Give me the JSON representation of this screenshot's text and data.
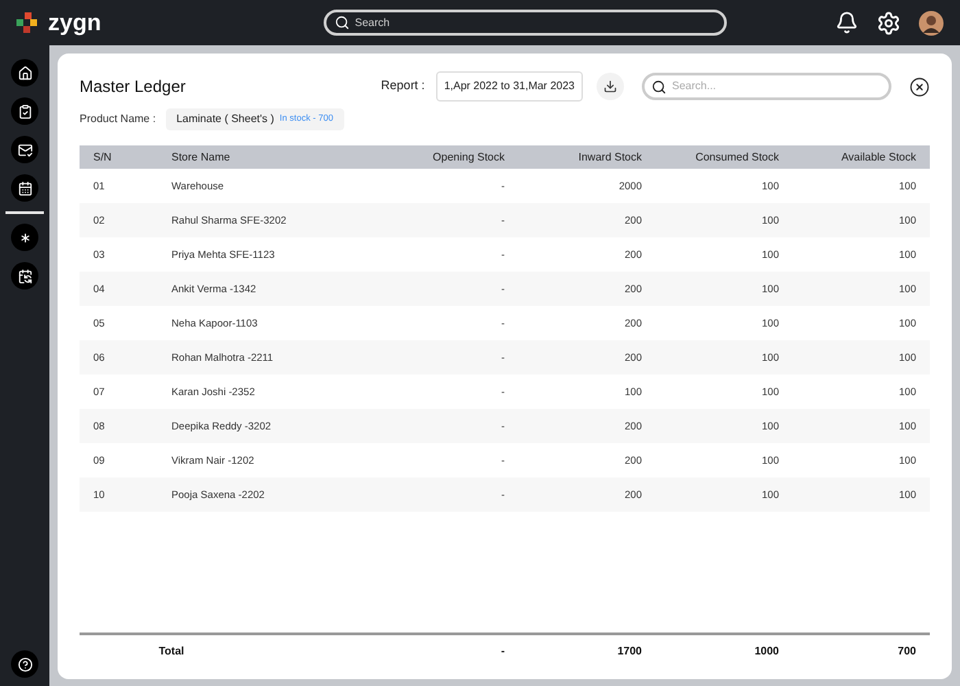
{
  "topbar": {
    "brand": "zygn",
    "search_placeholder": "Search"
  },
  "ledger": {
    "title": "Master Ledger",
    "report_label": "Report :",
    "report_range": "1,Apr 2022 to 31,Mar 2023",
    "search_placeholder": "Search...",
    "product_label": "Product Name :",
    "product": "Laminate ( Sheet's )",
    "stock_badge": "In stock - 700"
  },
  "table": {
    "columns": [
      "S/N",
      "Store Name",
      "Opening Stock",
      "Inward Stock",
      "Consumed Stock",
      "Available Stock"
    ],
    "rows": [
      [
        "01",
        "Warehouse",
        "-",
        "2000",
        "100",
        "100"
      ],
      [
        "02",
        "Rahul Sharma SFE-3202",
        "-",
        "200",
        "100",
        "100"
      ],
      [
        "03",
        "Priya Mehta SFE-1123",
        "-",
        "200",
        "100",
        "100"
      ],
      [
        "04",
        "Ankit Verma -1342",
        "-",
        "200",
        "100",
        "100"
      ],
      [
        "05",
        "Neha Kapoor-1103",
        "-",
        "200",
        "100",
        "100"
      ],
      [
        "06",
        "Rohan Malhotra -2211",
        "-",
        "200",
        "100",
        "100"
      ],
      [
        "07",
        "Karan Joshi -2352",
        "-",
        "100",
        "100",
        "100"
      ],
      [
        "08",
        "Deepika Reddy -3202",
        "-",
        "200",
        "100",
        "100"
      ],
      [
        "09",
        "Vikram Nair -1202",
        "-",
        "200",
        "100",
        "100"
      ],
      [
        "10",
        "Pooja Saxena -2202",
        "-",
        "200",
        "100",
        "100"
      ]
    ],
    "total": [
      "Total",
      "-",
      "1700",
      "1000",
      "700"
    ]
  }
}
